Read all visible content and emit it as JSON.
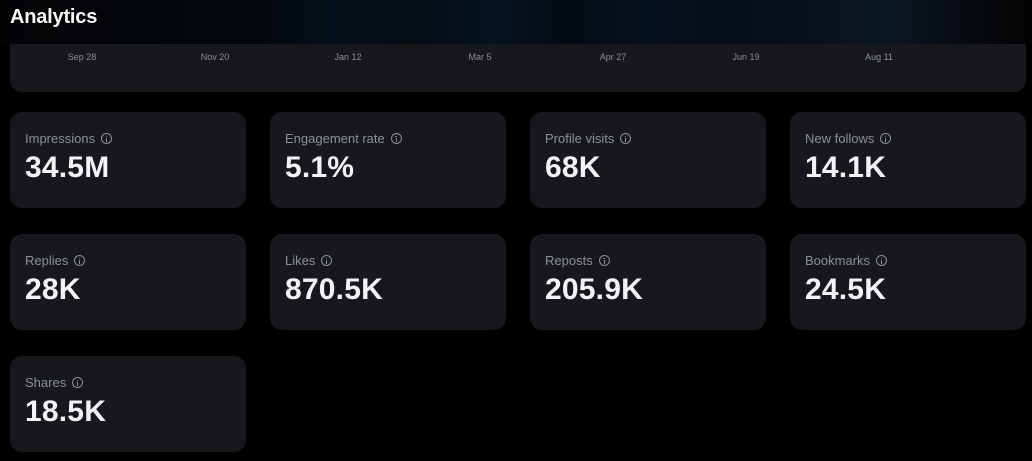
{
  "header": {
    "title": "Analytics"
  },
  "chart": {
    "x_ticks": [
      "Sep 28",
      "Nov 20",
      "Jan 12",
      "Mar 5",
      "Apr 27",
      "Jun 19",
      "Aug 11"
    ]
  },
  "metrics": [
    {
      "label": "Impressions",
      "value": "34.5M"
    },
    {
      "label": "Engagement rate",
      "value": "5.1%"
    },
    {
      "label": "Profile visits",
      "value": "68K"
    },
    {
      "label": "New follows",
      "value": "14.1K"
    },
    {
      "label": "Replies",
      "value": "28K"
    },
    {
      "label": "Likes",
      "value": "870.5K"
    },
    {
      "label": "Reposts",
      "value": "205.9K"
    },
    {
      "label": "Bookmarks",
      "value": "24.5K"
    },
    {
      "label": "Shares",
      "value": "18.5K"
    }
  ],
  "colors": {
    "background": "#000000",
    "card": "#16181c",
    "label": "#8b9096",
    "value": "#f1f3f4"
  }
}
